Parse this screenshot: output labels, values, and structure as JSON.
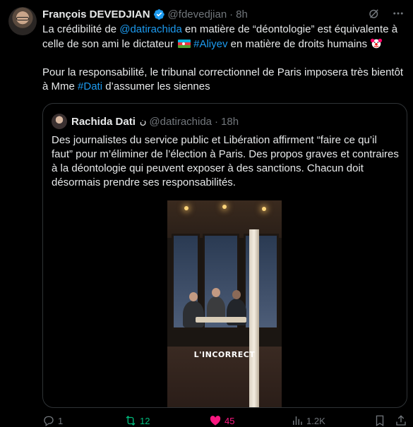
{
  "tweet": {
    "author_name": "François DEVEDJIAN",
    "author_handle": "@fdevedjian",
    "separator": "·",
    "time": "8h",
    "para1_a": "La crédibilité de ",
    "para1_mention": "@datirachida",
    "para1_b": " en matière de “déontologie” est équivalente à celle de son ami le dictateur ",
    "para1_hashtag": "#Aliyev",
    "para1_c": " en matière de droits humains",
    "para2_a": "Pour la responsabilité, le tribunal correctionnel de Paris imposera très bientôt à Mme ",
    "para2_hashtag": "#Dati",
    "para2_b": " d’assumer les siennes"
  },
  "quote": {
    "author_name": "Rachida Dati",
    "name_mark": "ن",
    "author_handle": "@datirachida",
    "separator": "·",
    "time": "18h",
    "text": "Des journalistes du service public et Libération affirment “faire ce qu’il faut” pour m’éliminer de l’élection à Paris. Des propos graves et contraires à la déontologie qui peuvent exposer à des sanctions. Chacun doit désormais prendre ses responsabilités.",
    "media_watermark": "L'INCORRECT"
  },
  "actions": {
    "replies": "1",
    "reposts": "12",
    "likes": "45",
    "views": "1.2K"
  },
  "colors": {
    "link": "#1d9bf0",
    "repost_active": "#00ba7c",
    "like_active": "#f91880",
    "muted": "#71767b"
  }
}
